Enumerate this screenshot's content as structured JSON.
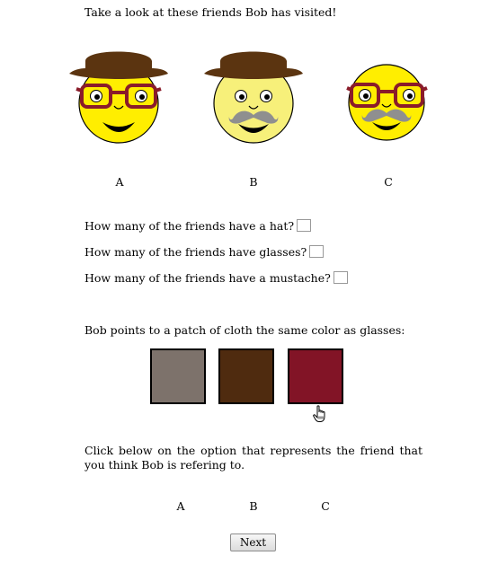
{
  "intro_text": "Take a look at these friends Bob has visited!",
  "friends": [
    {
      "label": "A",
      "hat": true,
      "glasses": true,
      "mustache": false,
      "face_color": "#ffee00"
    },
    {
      "label": "B",
      "hat": true,
      "glasses": false,
      "mustache": true,
      "face_color": "#f7f07a"
    },
    {
      "label": "C",
      "hat": false,
      "glasses": true,
      "mustache": true,
      "face_color": "#ffee00"
    }
  ],
  "questions": [
    {
      "text": "How many of the friends have a hat?",
      "value": ""
    },
    {
      "text": "How many of the friends have glasses?",
      "value": ""
    },
    {
      "text": "How many of the friends have a mustache?",
      "value": ""
    }
  ],
  "cloth_prompt": "Bob points to a patch of cloth the same color as glasses:",
  "swatches": [
    {
      "name": "gray",
      "color": "#7d726b"
    },
    {
      "name": "brown",
      "color": "#4f2b0f"
    },
    {
      "name": "red",
      "color": "#821426"
    }
  ],
  "colors": {
    "hat": "#5b3410",
    "glasses": "#8a1c2a",
    "mustache": "#8f8f8f"
  },
  "instruction": "Click below on the option that represents the friend that you think Bob is refering to.",
  "options": [
    "A",
    "B",
    "C"
  ],
  "next_label": "Next"
}
